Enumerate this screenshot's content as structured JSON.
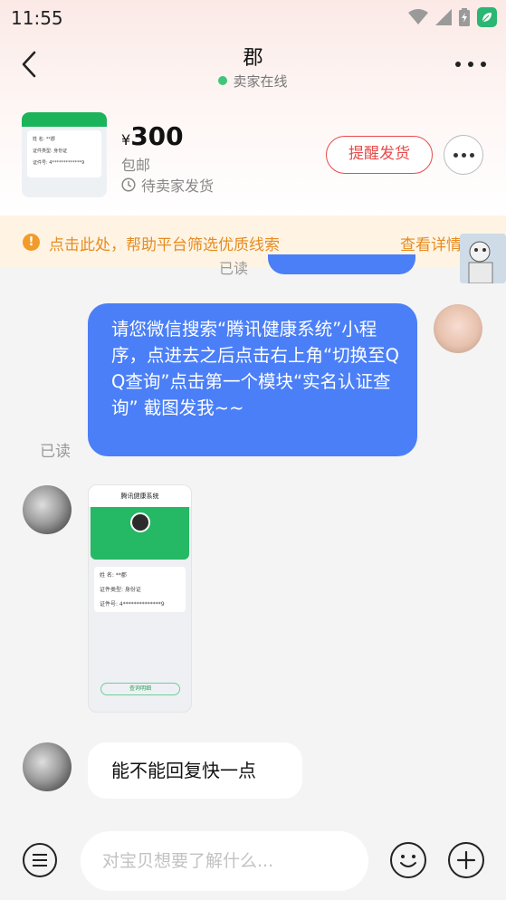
{
  "status_bar": {
    "time": "11:55"
  },
  "header": {
    "title": "郡",
    "status": "卖家在线"
  },
  "product": {
    "currency": "¥",
    "price": "300",
    "shipping": "包邮",
    "order_status": "待卖家发货",
    "remind_label": "提醒发货",
    "thumb_lines": [
      "姓 名: **郡",
      "证件类型: 身份证",
      "证件号: 4*************9"
    ]
  },
  "notice": {
    "text": "点击此处，帮助平台筛选优质线索",
    "link": "查看详情"
  },
  "messages": [
    {
      "from": "other",
      "read_label": "已读"
    },
    {
      "from": "me",
      "text": "请您微信搜索“腾讯健康系统”小程序，点进去之后点击右上角“切换至QQ查询”点击第一个模块“实名认证查询” 截图发我~~",
      "read_label": "已读"
    },
    {
      "from": "other",
      "type": "image",
      "image_title": "腾讯健康系统",
      "image_lines": [
        "姓 名: **郡",
        "证件类型: 身份证",
        "证件号: 4**************9"
      ],
      "image_button": "查询明细"
    },
    {
      "from": "other",
      "text": "能不能回复快一点"
    }
  ],
  "input": {
    "placeholder": "对宝贝想要了解什么..."
  },
  "colors": {
    "accent_blue": "#4b7ff7",
    "remind_red": "#e84a4a",
    "notice_orange": "#e58c22",
    "online_green": "#3cc779"
  },
  "icons": [
    "back-arrow-icon",
    "more-icon",
    "clock-icon",
    "warning-icon",
    "menu-icon",
    "emoji-icon",
    "plus-icon",
    "wifi-icon",
    "signal-icon",
    "battery-icon",
    "leaf-icon"
  ]
}
